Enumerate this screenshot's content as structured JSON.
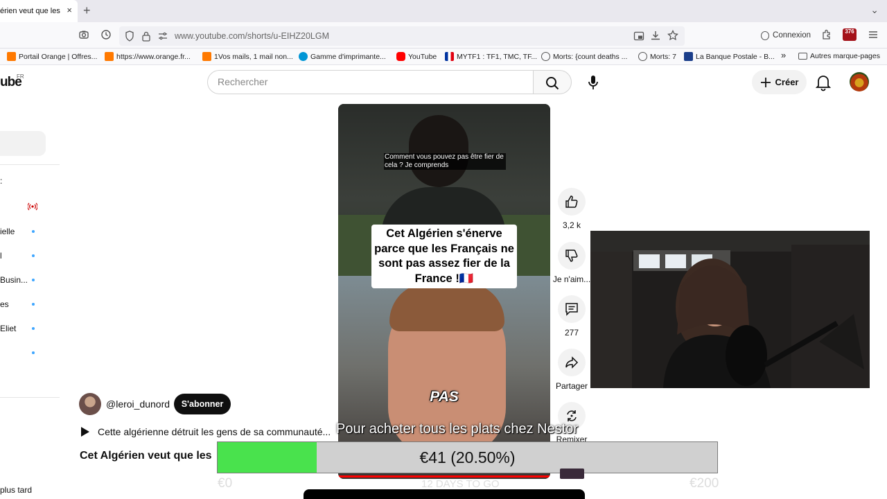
{
  "browser": {
    "tab_title": "érien veut que les Fr",
    "tab_close": "×",
    "new_tab": "+",
    "tabs_menu": "⌄",
    "url": "www.youtube.com/shorts/u-EIHZ20LGM",
    "connexion_label": "Connexion",
    "extension_badge": "376",
    "bookmarks": [
      {
        "label": "Portail Orange | Offres...",
        "color": "#ff7900"
      },
      {
        "label": "https://www.orange.fr...",
        "color": "#ff7900"
      },
      {
        "label": "1Vos mails, 1 mail non...",
        "color": "#ff7900"
      },
      {
        "label": "Gamme d'imprimante...",
        "color": "#0096d6"
      },
      {
        "label": "YouTube",
        "color": "#ff0000"
      },
      {
        "label": "MYTF1 : TF1, TMC, TF...",
        "color": "#0033a0"
      },
      {
        "label": "Morts: {count deaths ...",
        "color": "#555555"
      },
      {
        "label": "Morts: 7",
        "color": "#555555"
      },
      {
        "label": "La Banque Postale - B...",
        "color": "#1b3e8a"
      }
    ],
    "bookmarks_overflow": "»",
    "other_bookmarks": "Autres marque-pages"
  },
  "youtube": {
    "logo_text": "ube",
    "region": "FR",
    "search_placeholder": "Rechercher",
    "create_label": "Créer",
    "sidebar": [
      {
        "label": "ielle"
      },
      {
        "label": "l"
      },
      {
        "label": "Busin..."
      },
      {
        "label": "es"
      },
      {
        "label": "Eliet"
      },
      {
        "label": ""
      }
    ],
    "sidebar_small": ":",
    "later_label": "plus tard"
  },
  "short": {
    "subtitle": "Comment vous pouvez pas être fier de cela ? Je comprends",
    "title_overlay": "Cet Algérien s'énerve parce que les Français ne sont pas assez fier de la France !🇫🇷",
    "caption_word": "PAS",
    "likes": "3,2 k",
    "dislike_label": "Je n'aim...",
    "comments": "277",
    "share_label": "Partager",
    "remix_label": "Remixer",
    "channel": "@leroi_dunord",
    "subscribe_label": "S'abonner",
    "description": "Cette algérienne détruit les gens de sa communauté...",
    "video_title": "Cet Algérien veut que les"
  },
  "stream_overlay": {
    "caption": "Pour acheter tous les plats chez Nestor",
    "goal_text": "€41 (20.50%)",
    "goal_progress": 0.205,
    "goal_min": "€0",
    "goal_max": "€200",
    "goal_days": "12 DAYS TO GO",
    "fill_color": "#49e24d"
  }
}
